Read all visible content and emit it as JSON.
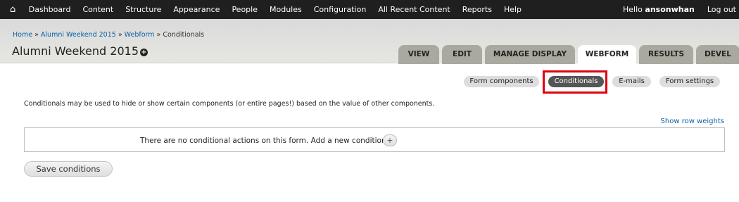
{
  "toolbar": {
    "home_icon": "home-icon",
    "items": [
      {
        "label": "Dashboard"
      },
      {
        "label": "Content"
      },
      {
        "label": "Structure"
      },
      {
        "label": "Appearance"
      },
      {
        "label": "People"
      },
      {
        "label": "Modules"
      },
      {
        "label": "Configuration"
      },
      {
        "label": "All Recent Content"
      },
      {
        "label": "Reports"
      },
      {
        "label": "Help"
      }
    ],
    "hello_prefix": "Hello ",
    "username": "ansonwhan",
    "logout": "Log out"
  },
  "breadcrumb": {
    "home": "Home",
    "sep": " » ",
    "parent": "Alumni Weekend 2015",
    "webform": "Webform",
    "current": "Conditionals"
  },
  "page": {
    "title": "Alumni Weekend 2015",
    "title_action_icon": "plus-circle-icon",
    "title_action_glyph": "+"
  },
  "tabs": [
    {
      "label": "View",
      "active": false
    },
    {
      "label": "Edit",
      "active": false
    },
    {
      "label": "Manage display",
      "active": false
    },
    {
      "label": "Webform",
      "active": true
    },
    {
      "label": "Results",
      "active": false
    },
    {
      "label": "Devel",
      "active": false
    }
  ],
  "subtabs": [
    {
      "label": "Form components",
      "active": false
    },
    {
      "label": "Conditionals",
      "active": true
    },
    {
      "label": "E-mails",
      "active": false
    },
    {
      "label": "Form settings",
      "active": false
    }
  ],
  "description": "Conditionals may be used to hide or show certain components (or entire pages!) based on the value of other components.",
  "row_weights_link": "Show row weights",
  "conditionals": {
    "empty_text": "There are no conditional actions on this form. Add a new condition:",
    "add_glyph": "+"
  },
  "save_button": "Save conditions",
  "colors": {
    "toolbar_bg": "#1f1f1f",
    "link": "#0b60a8",
    "active_subtab": "#555555",
    "highlight": "#e2000f"
  }
}
